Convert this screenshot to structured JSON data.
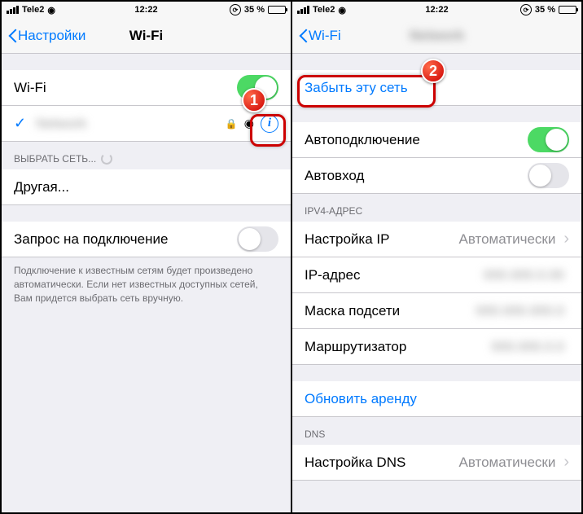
{
  "status": {
    "carrier": "Tele2",
    "time": "12:22",
    "battery_pct": "35 %"
  },
  "left": {
    "back_label": "Настройки",
    "title": "Wi-Fi",
    "wifi_toggle_label": "Wi-Fi",
    "choose_network_header": "ВЫБРАТЬ СЕТЬ...",
    "other_label": "Другая...",
    "ask_join_label": "Запрос на подключение",
    "footer": "Подключение к известным сетям будет произведено автоматически. Если нет известных доступных сетей, Вам придется выбрать сеть вручную.",
    "badge": "1"
  },
  "right": {
    "back_label": "Wi-Fi",
    "forget_label": "Забыть эту сеть",
    "auto_join_label": "Автоподключение",
    "auto_login_label": "Автовход",
    "ipv4_header": "IPV4-АДРЕС",
    "configure_ip_label": "Настройка IP",
    "configure_ip_value": "Автоматически",
    "ip_address_label": "IP-адрес",
    "subnet_label": "Маска подсети",
    "router_label": "Маршрутизатор",
    "renew_lease_label": "Обновить аренду",
    "dns_header": "DNS",
    "configure_dns_label": "Настройка DNS",
    "configure_dns_value": "Автоматически",
    "badge": "2"
  }
}
